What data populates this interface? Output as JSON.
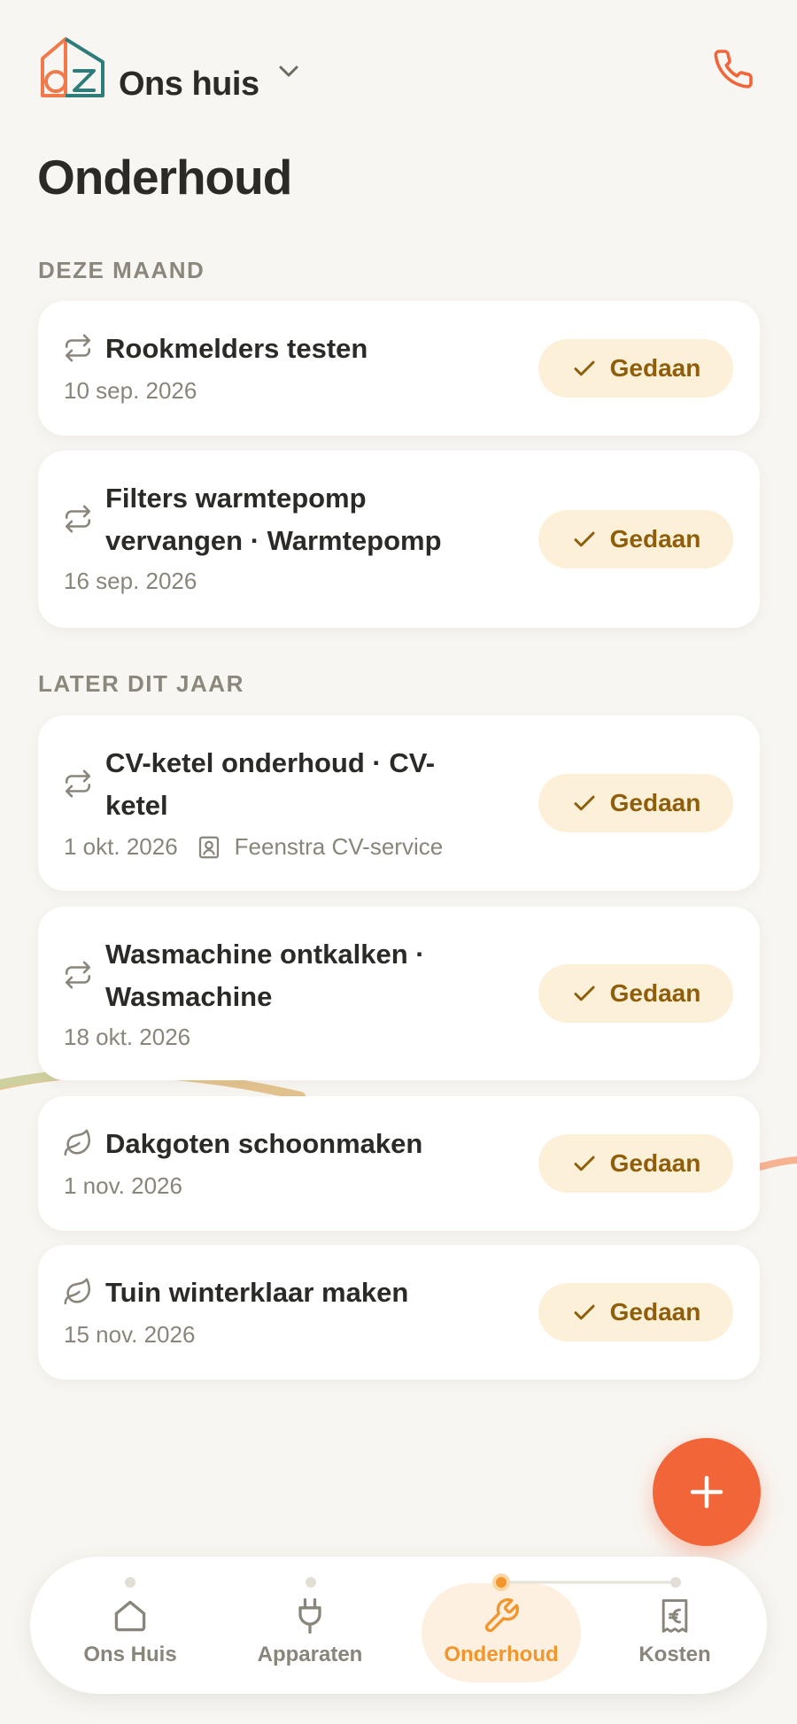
{
  "header": {
    "house_name": "Ons huis"
  },
  "page": {
    "title": "Onderhoud"
  },
  "sections": [
    {
      "label": "DEZE MAAND"
    },
    {
      "label": "LATER DIT JAAR"
    }
  ],
  "tasks": [
    {
      "title": "Rookmelders testen",
      "date": "10 sep. 2026",
      "icon": "repeat-icon",
      "done_label": "Gedaan"
    },
    {
      "title": "Filters warmtepomp vervangen · Warmtepomp",
      "date": "16 sep. 2026",
      "icon": "repeat-icon",
      "done_label": "Gedaan"
    },
    {
      "title": "CV-ketel onderhoud · CV-ketel",
      "date": "1 okt. 2026",
      "provider": "Feenstra CV-service",
      "icon": "repeat-icon",
      "done_label": "Gedaan"
    },
    {
      "title": "Wasmachine ontkalken · Wasmachine",
      "date": "18 okt. 2026",
      "icon": "repeat-icon",
      "done_label": "Gedaan"
    },
    {
      "title": "Dakgoten schoonmaken",
      "date": "1 nov. 2026",
      "icon": "leaf-icon",
      "done_label": "Gedaan"
    },
    {
      "title": "Tuin winterklaar maken",
      "date": "15 nov. 2026",
      "icon": "leaf-icon",
      "done_label": "Gedaan"
    }
  ],
  "nav": [
    {
      "label": "Ons Huis",
      "icon": "house-icon",
      "active": false
    },
    {
      "label": "Apparaten",
      "icon": "plug-icon",
      "active": false
    },
    {
      "label": "Onderhoud",
      "icon": "wrench-icon",
      "active": true
    },
    {
      "label": "Kosten",
      "icon": "receipt-euro-icon",
      "active": false
    }
  ],
  "colors": {
    "accent": "#f26539",
    "done_bg": "#fdf0d9",
    "done_text": "#8f5e0b",
    "nav_active": "#f2962b"
  }
}
